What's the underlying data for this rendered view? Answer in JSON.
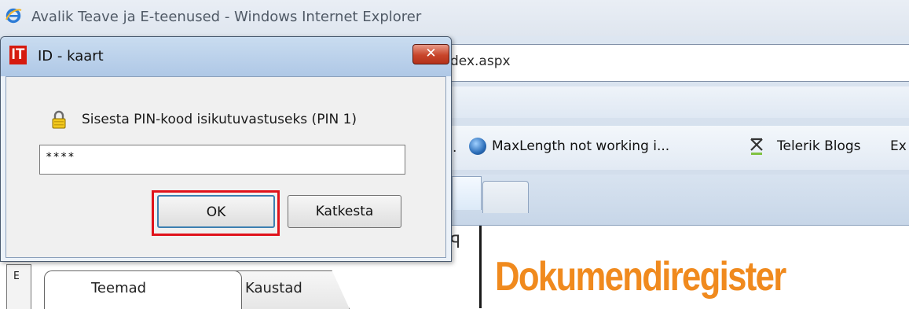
{
  "browser": {
    "window_title": "Avalik Teave ja E-teenused - Windows Internet Explorer",
    "address_partial": "dex.aspx",
    "favorites": {
      "leading_partial": ".",
      "items": [
        {
          "label": "MaxLength not working i...",
          "icon": "globe-icon"
        },
        {
          "label": "Telerik Blogs",
          "icon": "telerik-icon"
        },
        {
          "label": "Ex",
          "icon": ""
        }
      ]
    }
  },
  "page": {
    "heading": "Dokumendiregister",
    "heading_color": "#f08a1e",
    "side_grip_mark": "E",
    "pin_glyph": "ꟼ",
    "tabs": [
      {
        "label": "Teemad"
      },
      {
        "label": "Kaustad"
      }
    ]
  },
  "dialog": {
    "app_icon_text": "IT",
    "title": "ID - kaart",
    "close_label": "✕",
    "prompt": "Sisesta PIN-kood isikutuvastuseks (PIN 1)",
    "pin_value": "****",
    "buttons": {
      "ok": "OK",
      "cancel": "Katkesta"
    },
    "highlight_color": "#e0121b"
  }
}
